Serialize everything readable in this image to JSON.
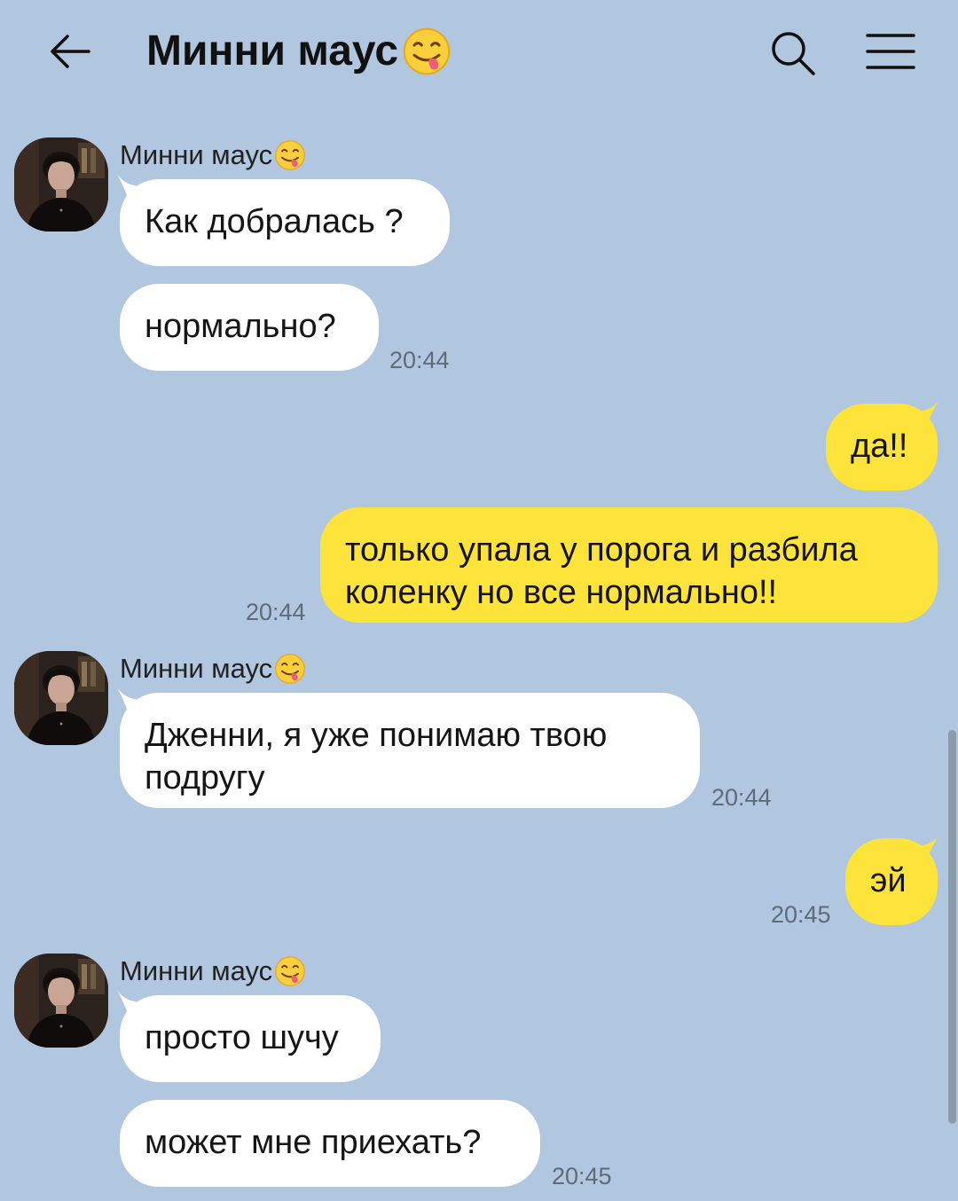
{
  "header": {
    "title": "Минни маус",
    "title_emoji": "yum-face-emoji",
    "back_icon": "arrow-left-icon",
    "search_icon": "search-icon",
    "menu_icon": "hamburger-menu-icon"
  },
  "colors": {
    "background": "#b1c6df",
    "incoming_bubble": "#ffffff",
    "outgoing_bubble": "#fee33b"
  },
  "messages": [
    {
      "direction": "in",
      "sender": "Минни маус",
      "text": "Как добралась ?",
      "time": ""
    },
    {
      "direction": "in",
      "sender": "",
      "text": "нормально?",
      "time": "20:44"
    },
    {
      "direction": "out",
      "text": "да!!",
      "time": ""
    },
    {
      "direction": "out",
      "text": "только упала у порога и разбила коленку но все нормально!!",
      "time": "20:44"
    },
    {
      "direction": "in",
      "sender": "Минни маус",
      "text": "Дженни, я уже понимаю твою подругу",
      "time": "20:44"
    },
    {
      "direction": "out",
      "text": "эй",
      "time": "20:45"
    },
    {
      "direction": "in",
      "sender": "Минни маус",
      "text": "просто шучу",
      "time": ""
    },
    {
      "direction": "in",
      "sender": "",
      "text": "может мне приехать?",
      "time": "20:45"
    }
  ]
}
